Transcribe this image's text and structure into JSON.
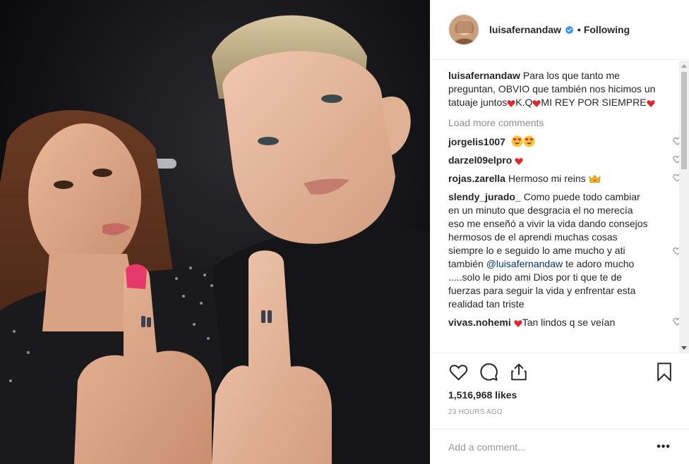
{
  "post": {
    "photo_icon": "photo-selfie",
    "accent_color": "#3897f0"
  },
  "header": {
    "username": "luisafernandaw",
    "separator": "•",
    "follow_label": "Following",
    "verified_icon": "verified-badge-icon"
  },
  "caption": {
    "username": "luisafernandaw",
    "text_1": "Para los que tanto me preguntan, OBVIO que también nos hicimos un tatuaje juntos",
    "text_2": "K.Q",
    "text_3": "MI REY POR SIEMPRE"
  },
  "load_more": "Load more comments",
  "comments": [
    {
      "username": "jorgelis1007",
      "text": ""
    },
    {
      "username": "darzel09elpro",
      "text": ""
    },
    {
      "username": "rojas.zarella",
      "text": "Hermoso mi reins"
    },
    {
      "username": "slendy_jurado_",
      "text": "Como puede todo cambiar en un minuto que desgracia el no merecía eso me enseñó a vivir la vida dando consejos hermosos de el aprendi muchas cosas siempre lo e seguido lo ame mucho y ati también",
      "mention": "@luisafernandaw",
      "text_after": "te adoro mucho .....solo le pido ami Dios por ti que te de fuerzas para seguir la vida y enfrentar esta realidad tan triste"
    },
    {
      "username": "vivas.nohemi",
      "text": "Tan lindos q se veían"
    }
  ],
  "actions": {
    "likes": "1,516,968 likes",
    "time": "23 HOURS AGO",
    "comment_placeholder": "Add a comment...",
    "more_label": "•••"
  }
}
